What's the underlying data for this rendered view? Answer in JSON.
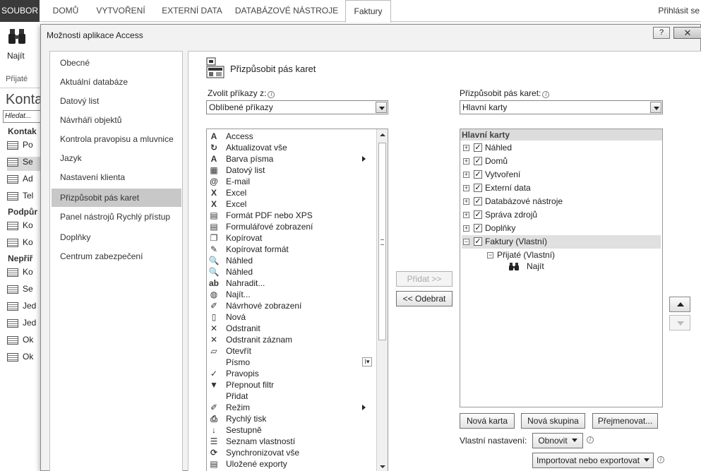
{
  "ribbon": {
    "tabs": [
      "SOUBOR",
      "DOMŮ",
      "VYTVOŘENÍ",
      "EXTERNÍ DATA",
      "DATABÁZOVÉ NÁSTROJE",
      "Faktury"
    ],
    "signin": "Přihlásit se",
    "find_label": "Najít",
    "group_label": "Přijaté"
  },
  "nav": {
    "title": "Konta",
    "search_placeholder": "Hledat...",
    "groups": [
      "Kontak",
      "Podpůr",
      "Nepřiř"
    ],
    "objects": [
      "Po",
      "Se",
      "Ad",
      "Tel",
      "Ko",
      "Ko",
      "Ko",
      "Se",
      "Jed",
      "Jed",
      "Ok",
      "Ok"
    ]
  },
  "dialog": {
    "title": "Možnosti aplikace Access",
    "help": "?",
    "close": "✕",
    "categories": [
      "Obecné",
      "Aktuální databáze",
      "Datový list",
      "Návrháři objektů",
      "Kontrola pravopisu a mluvnice",
      "Jazyk",
      "Nastavení klienta",
      "Přizpůsobit pás karet",
      "Panel nástrojů Rychlý přístup",
      "Doplňky",
      "Centrum zabezpečení"
    ],
    "panel_title": "Přizpůsobit pás karet",
    "choose_label": "Zvolit příkazy z:",
    "choose_value": "Oblíbené příkazy",
    "customize_label": "Přizpůsobit pás karet:",
    "customize_value": "Hlavní karty",
    "commands": [
      {
        "icon": "A",
        "label": "Access"
      },
      {
        "icon": "↻",
        "label": "Aktualizovat vše"
      },
      {
        "icon": "A",
        "label": "Barva písma"
      },
      {
        "icon": "▦",
        "label": "Datový list"
      },
      {
        "icon": "@",
        "label": "E-mail"
      },
      {
        "icon": "X",
        "label": "Excel"
      },
      {
        "icon": "X",
        "label": "Excel"
      },
      {
        "icon": "▤",
        "label": "Formát PDF nebo XPS"
      },
      {
        "icon": "▤",
        "label": "Formulářové zobrazení"
      },
      {
        "icon": "❐",
        "label": "Kopírovat"
      },
      {
        "icon": "✎",
        "label": "Kopírovat formát"
      },
      {
        "icon": "🔍",
        "label": "Náhled"
      },
      {
        "icon": "🔍",
        "label": "Náhled"
      },
      {
        "icon": "ab",
        "label": "Nahradit..."
      },
      {
        "icon": "◍",
        "label": "Najít..."
      },
      {
        "icon": "✐",
        "label": "Návrhové zobrazení"
      },
      {
        "icon": "▯",
        "label": "Nová"
      },
      {
        "icon": "✕",
        "label": "Odstranit"
      },
      {
        "icon": "✕",
        "label": "Odstranit záznam"
      },
      {
        "icon": "▱",
        "label": "Otevřít"
      },
      {
        "icon": "",
        "label": "Písmo"
      },
      {
        "icon": "✓",
        "label": "Pravopis"
      },
      {
        "icon": "▼",
        "label": "Přepnout filtr"
      },
      {
        "icon": "",
        "label": "Přidat"
      },
      {
        "icon": "✐",
        "label": "Režim"
      },
      {
        "icon": "⎙",
        "label": "Rychlý tisk"
      },
      {
        "icon": "↓",
        "label": "Sestupně"
      },
      {
        "icon": "☰",
        "label": "Seznam vlastností"
      },
      {
        "icon": "⟳",
        "label": "Synchronizovat vše"
      },
      {
        "icon": "▤",
        "label": "Uložené exporty"
      }
    ],
    "add_button": "Přidat >>",
    "remove_button": "<< Odebrat",
    "tree_header": "Hlavní karty",
    "tree": [
      {
        "label": "Náhled",
        "exp": "+",
        "checked": true
      },
      {
        "label": "Domů",
        "exp": "+",
        "checked": true
      },
      {
        "label": "Vytvoření",
        "exp": "+",
        "checked": true
      },
      {
        "label": "Externí data",
        "exp": "+",
        "checked": true
      },
      {
        "label": "Databázové nástroje",
        "exp": "+",
        "checked": true
      },
      {
        "label": "Správa zdrojů",
        "exp": "+",
        "checked": true
      },
      {
        "label": "Doplňky",
        "exp": "+",
        "checked": true
      },
      {
        "label": "Faktury (Vlastní)",
        "exp": "−",
        "checked": true
      }
    ],
    "subgroup": "Přijaté (Vlastní)",
    "subitem": "Najít",
    "new_tab": "Nová karta",
    "new_group": "Nová skupina",
    "rename": "Přejmenovat...",
    "custom_label": "Vlastní nastavení:",
    "reset": "Obnovit",
    "import_export": "Importovat nebo exportovat"
  }
}
